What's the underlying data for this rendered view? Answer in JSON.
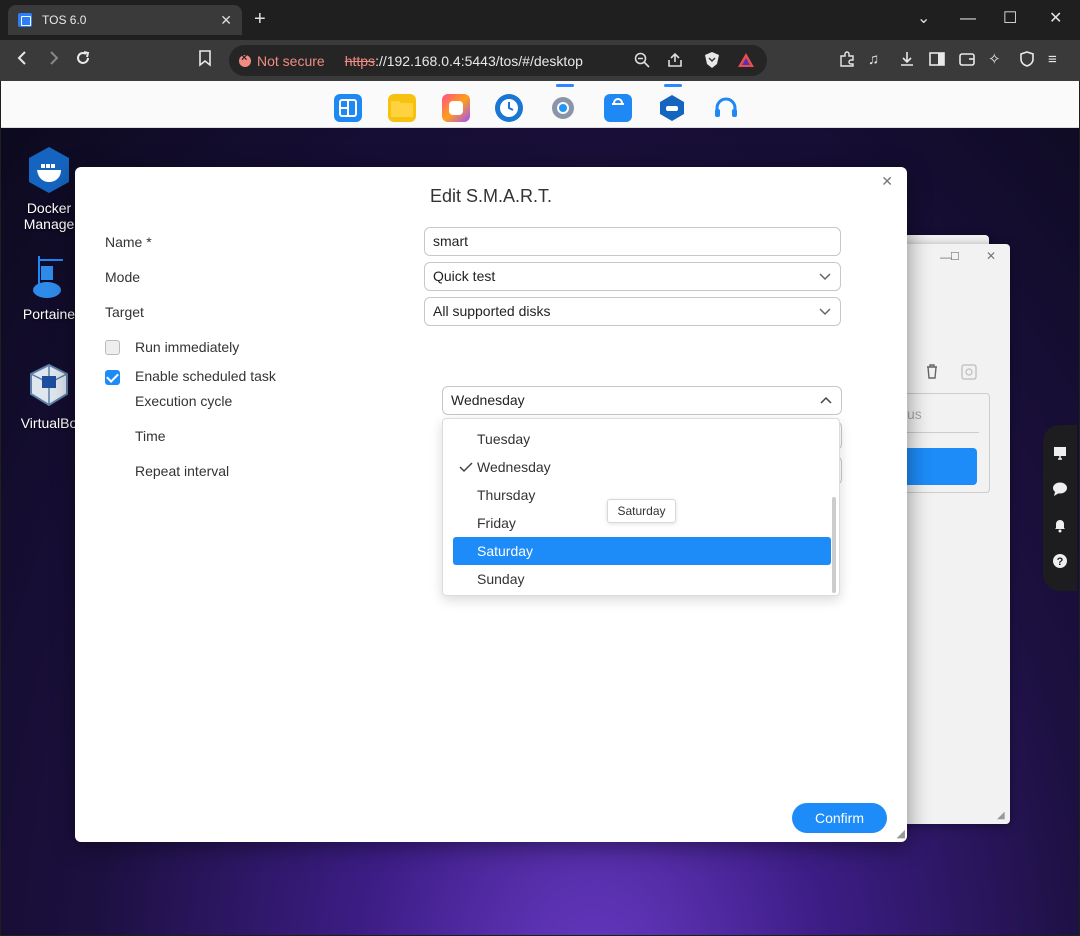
{
  "browser": {
    "tab_title": "TOS 6.0",
    "tab_close": "✕",
    "new_tab": "+",
    "security_label": "Not secure",
    "url_scheme": "https",
    "url_rest": "://192.168.0.4:5443/tos/#/desktop"
  },
  "desktop": {
    "apps": [
      {
        "label": "Docker\nManage"
      },
      {
        "label": "Portaine"
      },
      {
        "label": "VirtualBo"
      }
    ],
    "bg_window_fragment": "us"
  },
  "dialog": {
    "title": "Edit S.M.A.R.T.",
    "fields": {
      "name_label": "Name *",
      "name_value": "smart",
      "mode_label": "Mode",
      "mode_value": "Quick test",
      "target_label": "Target",
      "target_value": "All supported disks",
      "run_immediately_label": "Run immediately",
      "enable_scheduled_label": "Enable scheduled task",
      "execution_cycle_label": "Execution cycle",
      "execution_cycle_value": "Wednesday",
      "time_label": "Time",
      "repeat_interval_label": "Repeat interval"
    },
    "run_immediately_checked": false,
    "enable_scheduled_checked": true,
    "dropdown_options": [
      "Tuesday",
      "Wednesday",
      "Thursday",
      "Friday",
      "Saturday",
      "Sunday"
    ],
    "dropdown_checked": "Wednesday",
    "dropdown_highlighted": "Saturday",
    "tooltip": "Saturday",
    "confirm_label": "Confirm"
  },
  "colors": {
    "accent": "#1d8cf8",
    "not_secure": "#f28b82"
  }
}
